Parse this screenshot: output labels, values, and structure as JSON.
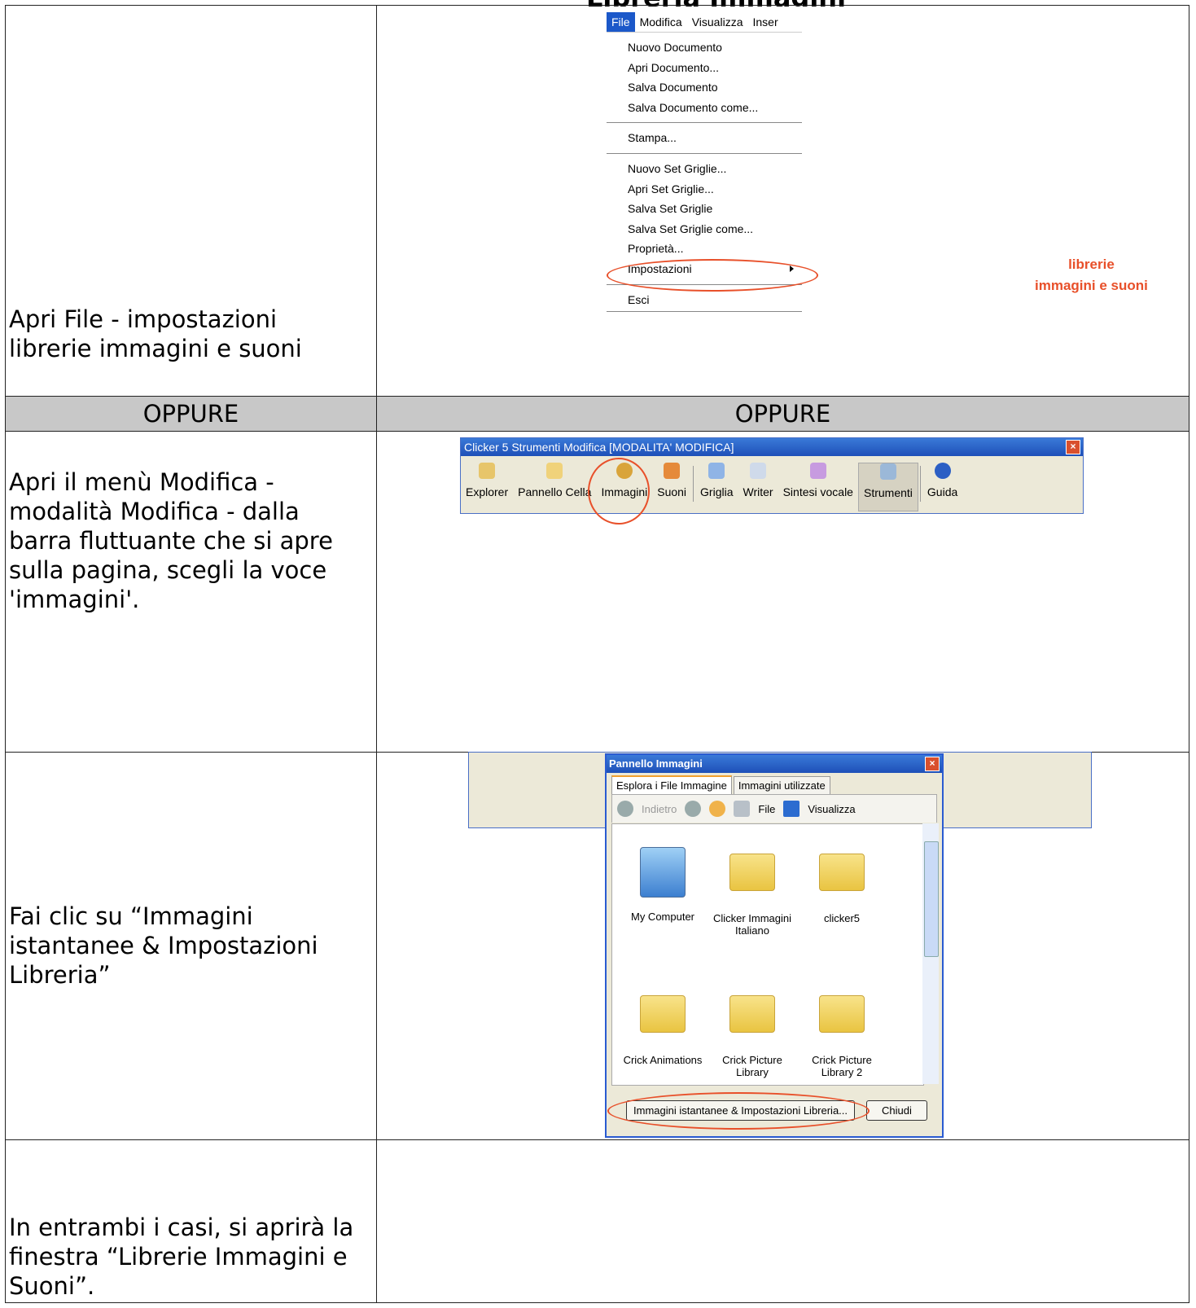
{
  "page_title_partial": "Libreria Immagini",
  "rows": [
    {
      "desc_lines": [
        "Apri File - impostazioni",
        "librerie immagini e suoni"
      ]
    },
    {
      "alt_left": "OPPURE",
      "alt_right": "OPPURE"
    },
    {
      "desc_lines": [
        "Apri il menù Modifica -",
        "modalità Modifica - dalla",
        "barra fluttuante che si apre",
        "sulla pagina, scegli la voce",
        "'immagini'."
      ]
    },
    {
      "desc_lines": [
        "Fai clic su “Immagini",
        "istantanee & Impostazioni",
        "Libreria”"
      ]
    },
    {
      "desc_lines": [
        "In entrambi i casi, si aprirà la",
        "finestra “Librerie Immagini e",
        "Suoni”."
      ]
    }
  ],
  "file_menu": {
    "menubar": [
      "File",
      "Modifica",
      "Visualizza",
      "Inser"
    ],
    "items": [
      "Nuovo Documento",
      "Apri Documento...",
      "Salva Documento",
      "Salva Documento come...",
      "Stampa...",
      "Nuovo Set Griglie...",
      "Apri Set Griglie...",
      "Salva Set Griglie",
      "Salva Set Griglie come...",
      "Proprietà...",
      "Impostazioni",
      "Esci"
    ],
    "callout": [
      "librerie",
      "immagini e suoni"
    ]
  },
  "toolbar": {
    "title": "Clicker 5 Strumenti Modifica [MODALITA' MODIFICA]",
    "close": "×",
    "buttons": [
      "Explorer",
      "Pannello Cella",
      "Immagini",
      "Suoni",
      "Griglia",
      "Writer",
      "Sintesi vocale",
      "Strumenti",
      "Guida"
    ]
  },
  "image_panel": {
    "title": "Pannello Immagini",
    "close": "×",
    "tabs": [
      "Esplora i File Immagine",
      "Immagini utilizzate"
    ],
    "nav": {
      "back": "Indietro",
      "file": "File",
      "view": "Visualizza"
    },
    "items": [
      {
        "label": "My Computer",
        "type": "computer"
      },
      {
        "label": "Clicker Immagini Italiano",
        "type": "folder"
      },
      {
        "label": "clicker5",
        "type": "folder"
      },
      {
        "label": "Crick Animations",
        "type": "folder"
      },
      {
        "label": "Crick Picture Library",
        "type": "folder"
      },
      {
        "label": "Crick Picture Library 2",
        "type": "folder"
      }
    ],
    "buttons": {
      "settings": "Immagini istantanee & Impostazioni Libreria...",
      "close": "Chiudi"
    }
  },
  "colors": {
    "accent": "#e8502a",
    "title_blue": "#1e4fb8",
    "menu_highlight": "#1b58c9",
    "alt_row_bg": "#c8c8c8"
  }
}
